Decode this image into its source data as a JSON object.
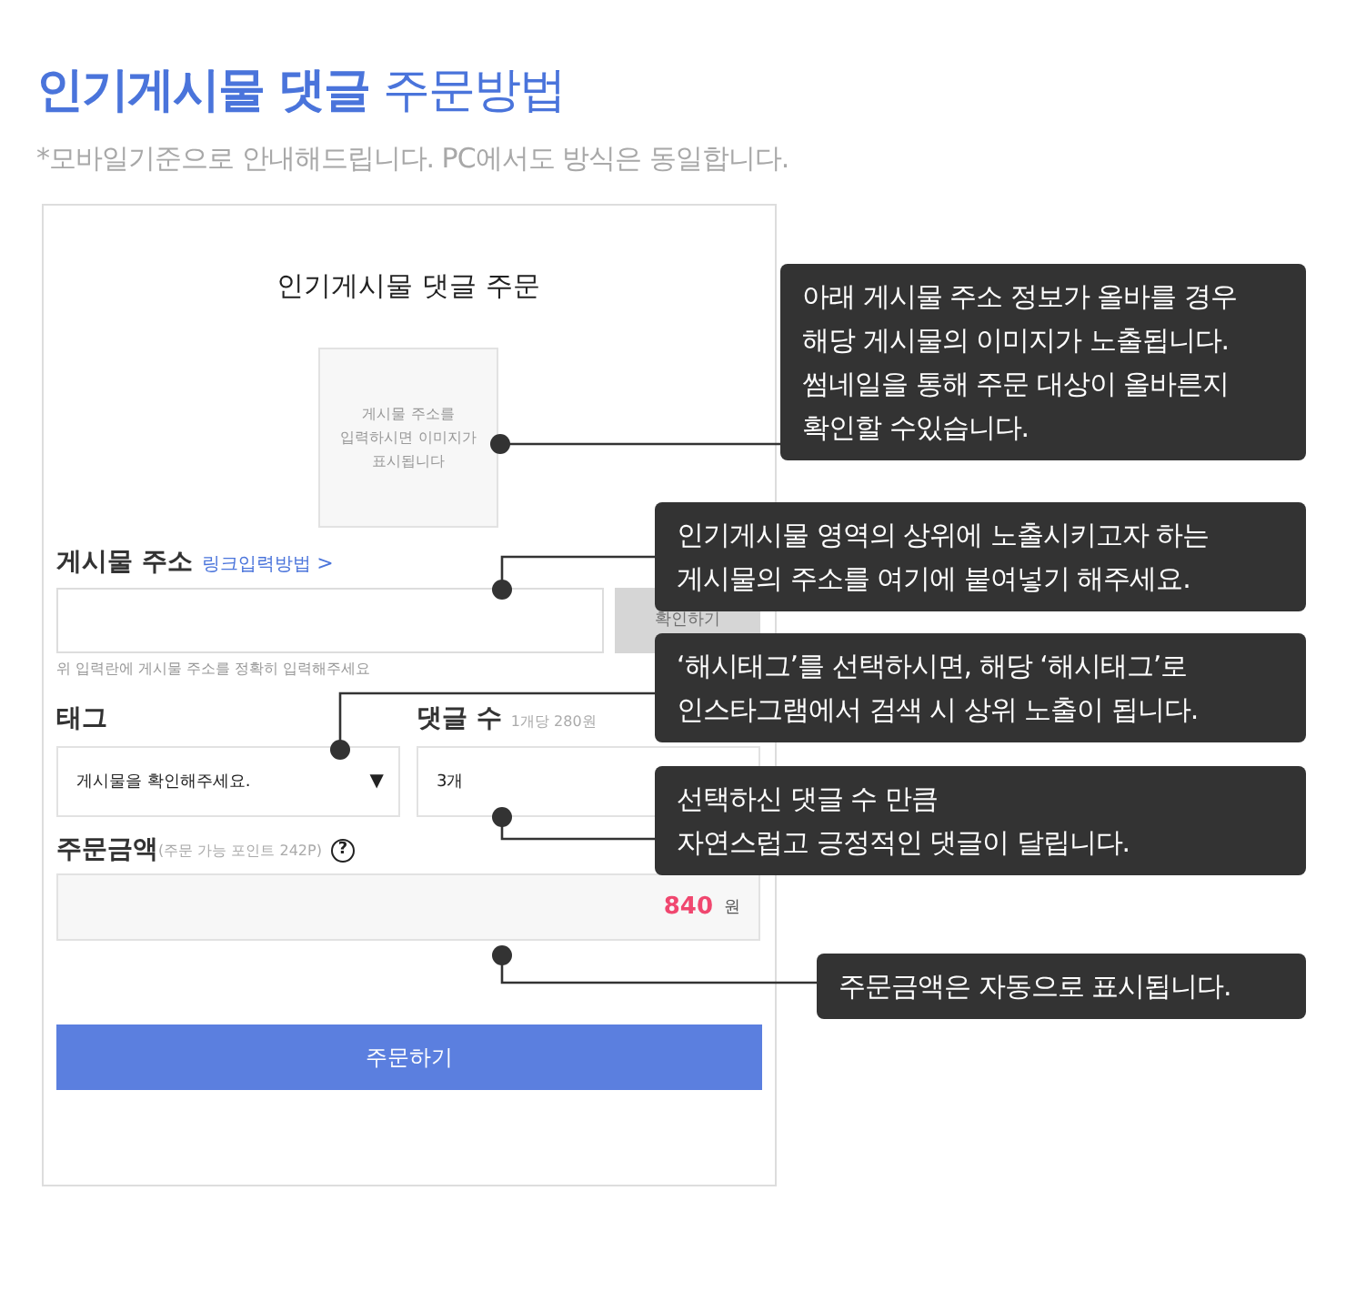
{
  "header": {
    "title_strong": "인기게시물 댓글",
    "title_rest": "주문방법",
    "note": "*모바일기준으로 안내해드립니다. PC에서도 방식은 동일합니다."
  },
  "form": {
    "title": "인기게시물 댓글 주문",
    "thumbnail_hint": "게시물 주소를\n입력하시면 이미지가\n표시됩니다",
    "address": {
      "label": "게시물 주소",
      "link": "링크입력방법",
      "link_icon": ">",
      "button": "확인하기",
      "help": "위 입력란에 게시물 주소를 정확히 입력해주세요"
    },
    "tag": {
      "label": "태그",
      "value": "게시물을 확인해주세요.",
      "arrow": "▼"
    },
    "count": {
      "label": "댓글 수",
      "note": "1개당 280원",
      "value": "3개"
    },
    "amount": {
      "label": "주문금액",
      "note": "(주문 가능 포인트 242P)",
      "help_icon": "?",
      "value": "840",
      "unit": "원"
    },
    "submit": "주문하기"
  },
  "callouts": [
    {
      "text": "아래 게시물 주소 정보가 올바를 경우\n해당 게시물의 이미지가 노출됩니다.\n썸네일을 통해 주문 대상이 올바른지\n확인할 수있습니다."
    },
    {
      "text": "인기게시물 영역의 상위에 노출시키고자 하는\n게시물의 주소를 여기에 붙여넣기 해주세요."
    },
    {
      "text": "‘해시태그’를 선택하시면, 해당 ‘해시태그’로\n인스타그램에서 검색 시 상위 노출이 됩니다."
    },
    {
      "text": "선택하신 댓글 수 만큼\n자연스럽고 긍정적인 댓글이 달립니다."
    },
    {
      "text": "주문금액은 자동으로 표시됩니다."
    }
  ]
}
